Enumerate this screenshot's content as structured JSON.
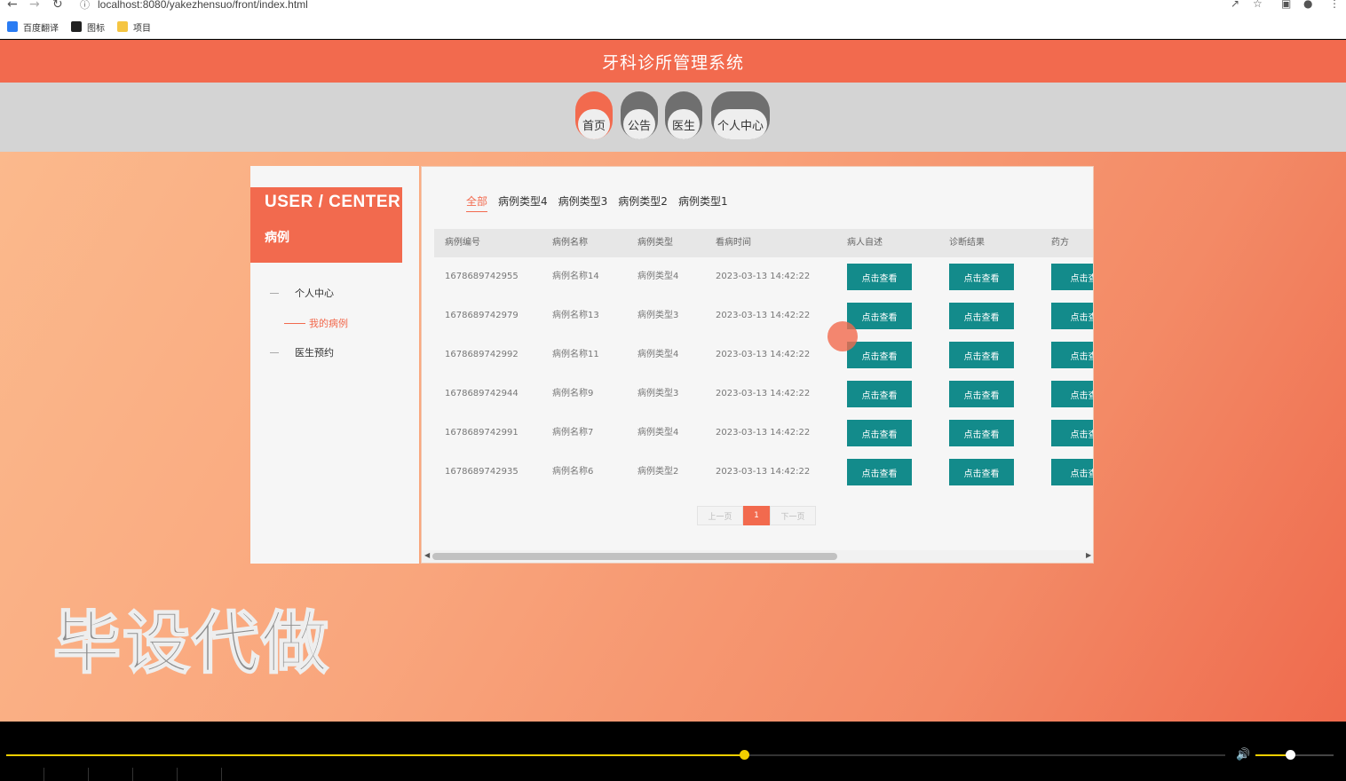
{
  "browser": {
    "url": "localhost:8080/yakezhensuo/front/index.html",
    "bookmarks": [
      {
        "label": "百度翻译",
        "icon": "translate-icon",
        "color": "#2a7cf3"
      },
      {
        "label": "图标",
        "icon": "image-icon",
        "color": "#222222"
      },
      {
        "label": "项目",
        "icon": "folder-icon",
        "color": "#f5c542"
      }
    ]
  },
  "app": {
    "title": "牙科诊所管理系统",
    "accent": "#f26a4e"
  },
  "nav": {
    "items": [
      {
        "label": "首页",
        "active": true
      },
      {
        "label": "公告",
        "active": false
      },
      {
        "label": "医生",
        "active": false
      },
      {
        "label": "个人中心",
        "active": false
      }
    ]
  },
  "sidebar": {
    "title": "USER / CENTER",
    "subtitle": "病例",
    "items": [
      {
        "label": "个人中心"
      },
      {
        "label": "我的病例"
      },
      {
        "label": "医生预约"
      }
    ]
  },
  "filters": {
    "tabs": [
      "全部",
      "病例类型4",
      "病例类型3",
      "病例类型2",
      "病例类型1"
    ]
  },
  "table": {
    "headers": [
      "病例编号",
      "病例名称",
      "病例类型",
      "看病时间",
      "病人自述",
      "诊断结果",
      "药方"
    ],
    "button_label": "点击查看",
    "button_label_cut": "点击查",
    "button_color": "#138b8b",
    "rows": [
      {
        "id": "1678689742955",
        "name": "病例名称14",
        "type": "病例类型4",
        "time": "2023-03-13 14:42:22"
      },
      {
        "id": "1678689742979",
        "name": "病例名称13",
        "type": "病例类型3",
        "time": "2023-03-13 14:42:22"
      },
      {
        "id": "1678689742992",
        "name": "病例名称11",
        "type": "病例类型4",
        "time": "2023-03-13 14:42:22"
      },
      {
        "id": "1678689742944",
        "name": "病例名称9",
        "type": "病例类型3",
        "time": "2023-03-13 14:42:22"
      },
      {
        "id": "1678689742991",
        "name": "病例名称7",
        "type": "病例类型4",
        "time": "2023-03-13 14:42:22"
      },
      {
        "id": "1678689742935",
        "name": "病例名称6",
        "type": "病例类型2",
        "time": "2023-03-13 14:42:22"
      }
    ]
  },
  "pager": {
    "prev": "上一页",
    "current": "1",
    "next": "下一页"
  },
  "watermark": "毕设代做",
  "player": {
    "progress": 0.605,
    "volume": 0.44,
    "accent": "#f2cf00"
  }
}
